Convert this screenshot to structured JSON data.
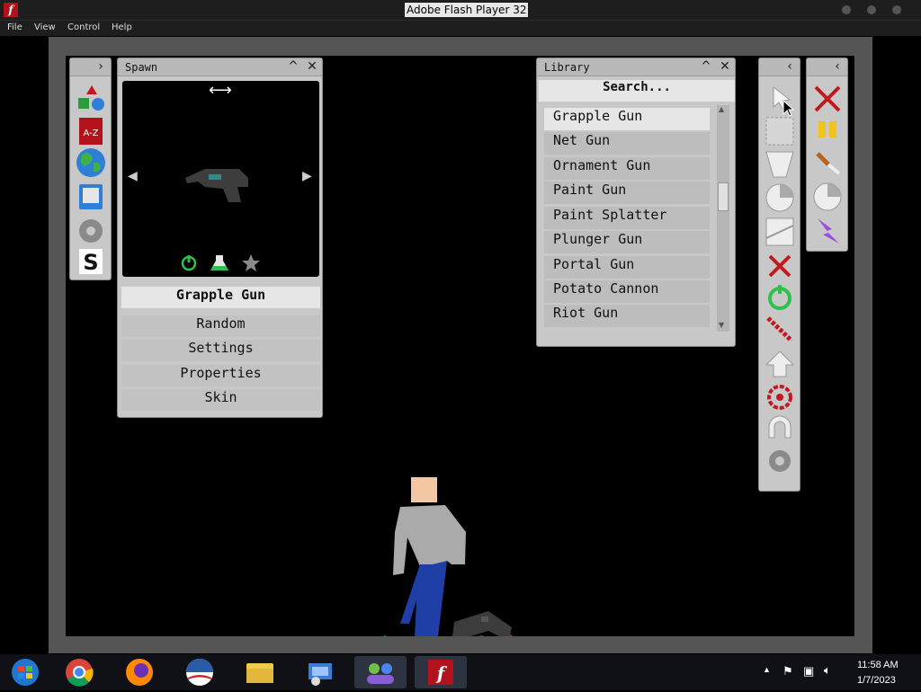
{
  "window": {
    "title": "Adobe Flash Player 32",
    "icon": "flash-icon"
  },
  "menu": [
    "File",
    "View",
    "Control",
    "Help"
  ],
  "spawn_panel": {
    "title": "Spawn",
    "selected_item": "Grapple Gun",
    "buttons": [
      "Random",
      "Settings",
      "Properties",
      "Skin"
    ],
    "category_icons": [
      "shapes-icon",
      "a-z-book-icon",
      "globe-icon",
      "save-disk-icon",
      "gear-icon",
      "s-logo-icon"
    ],
    "arrow_horizontal": "⟷",
    "arrow_left": "◀",
    "arrow_right": "▶"
  },
  "library_panel": {
    "title": "Library",
    "search_placeholder": "Search...",
    "items": [
      "Grapple Gun",
      "Net Gun",
      "Ornament Gun",
      "Paint Gun",
      "Paint Splatter",
      "Plunger Gun",
      "Portal Gun",
      "Potato Cannon",
      "Riot Gun"
    ],
    "selected_index": 0
  },
  "toolbar": {
    "tools": [
      "pointer-tool",
      "select-box-tool",
      "funnel-tool",
      "pie-tool",
      "slope-tool",
      "delete-tool",
      "power-tool",
      "rope-tool",
      "arrow-up-tool",
      "target-tool",
      "magnet-tool",
      "gear-tool"
    ]
  },
  "side_toolbar": {
    "tools": [
      "close-tool",
      "pause-tool",
      "knife-tool",
      "pie-tool",
      "lightning-tool"
    ]
  },
  "taskbar": {
    "apps": [
      "windows-start-icon",
      "chrome-icon",
      "firefox-icon",
      "obama-logo-icon",
      "file-explorer-icon",
      "control-panel-icon",
      "users-icon",
      "flash-player-icon"
    ],
    "time": "11:58 AM",
    "date": "1/7/2023"
  },
  "colors": {
    "accent_red": "#c2191f",
    "panel": "#c8c8c8",
    "stage": "#000000"
  }
}
